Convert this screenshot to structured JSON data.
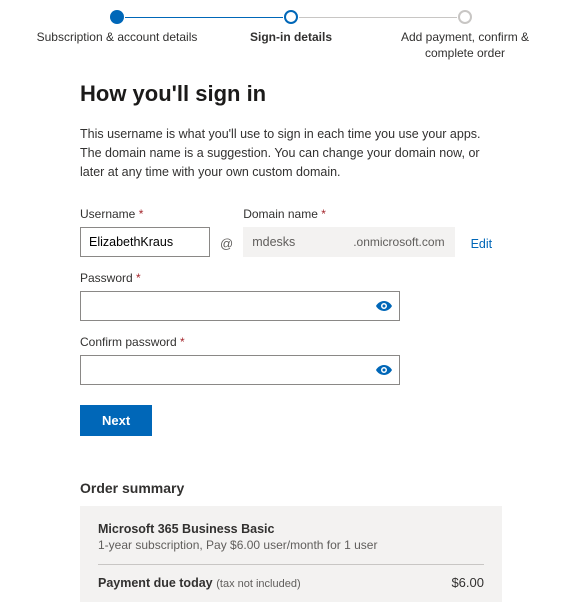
{
  "stepper": {
    "step1": "Subscription & account details",
    "step2": "Sign-in details",
    "step3": "Add payment, confirm & complete order"
  },
  "heading": "How you'll sign in",
  "intro": "This username is what you'll use to sign in each time you use your apps. The domain name is a suggestion. You can change your domain now, or later at any time with your own custom domain.",
  "form": {
    "username_label": "Username",
    "username_value": "ElizabethKraus",
    "at": "@",
    "domain_label": "Domain name",
    "domain_value": "mdesks",
    "domain_suffix": ".onmicrosoft.com",
    "edit": "Edit",
    "password_label": "Password",
    "confirm_label": "Confirm password",
    "next": "Next"
  },
  "order": {
    "title": "Order summary",
    "plan_name": "Microsoft 365 Business Basic",
    "plan_desc": "1-year subscription, Pay $6.00 user/month for 1 user",
    "payment_label": "Payment due today",
    "tax_note": "(tax not included)",
    "amount": "$6.00"
  }
}
